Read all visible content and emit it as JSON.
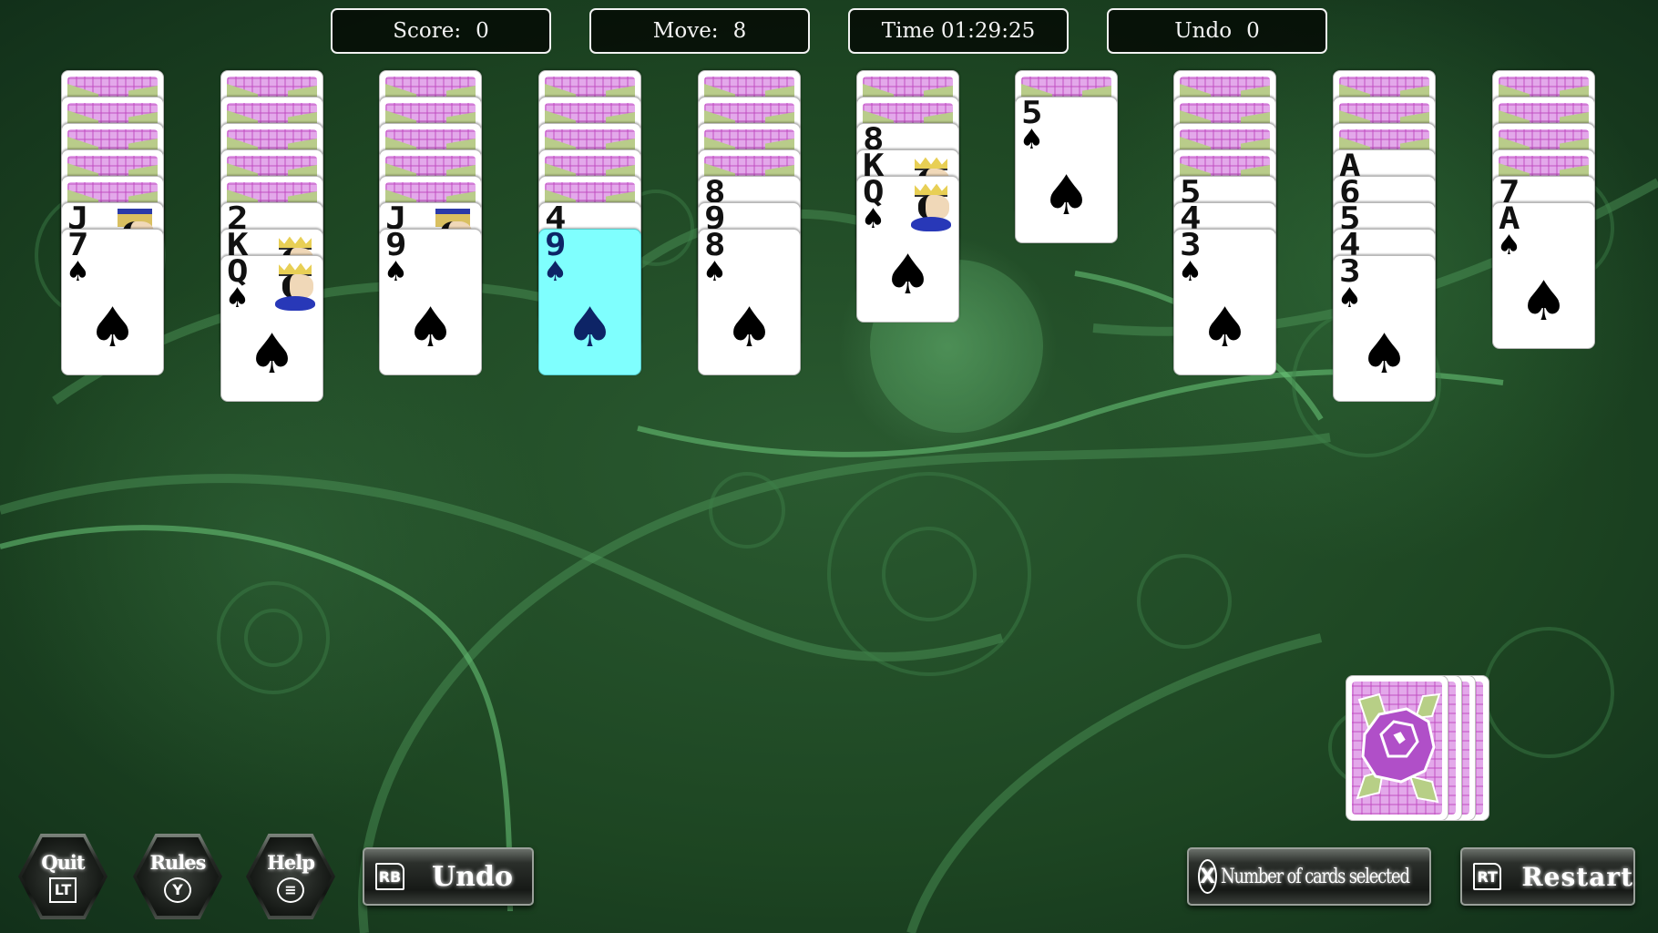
{
  "hud": {
    "score_label": "Score:",
    "score_value": "0",
    "move_label": "Move:",
    "move_value": "8",
    "time_label": "Time",
    "time_value": "01:29:25",
    "undo_label": "Undo",
    "undo_value": "0"
  },
  "colors": {
    "selected_card": "#7ffffe",
    "selected_ink": "#0d2466",
    "card_back": "#e3a8ea",
    "felt": "#1d4522"
  },
  "suit_symbol": "♠",
  "tableau": [
    {
      "hidden": 5,
      "face_up": [
        {
          "rank": "J",
          "royal": "jack"
        },
        {
          "rank": "7"
        }
      ]
    },
    {
      "hidden": 5,
      "face_up": [
        {
          "rank": "2"
        },
        {
          "rank": "K",
          "royal": "king"
        },
        {
          "rank": "Q",
          "royal": "queen"
        }
      ]
    },
    {
      "hidden": 5,
      "face_up": [
        {
          "rank": "J",
          "royal": "jack"
        },
        {
          "rank": "9"
        }
      ]
    },
    {
      "hidden": 5,
      "face_up": [
        {
          "rank": "4"
        },
        {
          "rank": "9",
          "selected": true
        }
      ]
    },
    {
      "hidden": 4,
      "face_up": [
        {
          "rank": "8"
        },
        {
          "rank": "9"
        },
        {
          "rank": "8"
        }
      ]
    },
    {
      "hidden": 2,
      "face_up": [
        {
          "rank": "8"
        },
        {
          "rank": "K",
          "royal": "king"
        },
        {
          "rank": "Q",
          "royal": "queen"
        }
      ]
    },
    {
      "hidden": 1,
      "face_up": [
        {
          "rank": "5"
        }
      ]
    },
    {
      "hidden": 4,
      "face_up": [
        {
          "rank": "5"
        },
        {
          "rank": "4"
        },
        {
          "rank": "3"
        }
      ]
    },
    {
      "hidden": 3,
      "face_up": [
        {
          "rank": "A"
        },
        {
          "rank": "6"
        },
        {
          "rank": "5"
        },
        {
          "rank": "4"
        },
        {
          "rank": "3"
        }
      ]
    },
    {
      "hidden": 4,
      "face_up": [
        {
          "rank": "7"
        },
        {
          "rank": "A"
        }
      ]
    }
  ],
  "stock": {
    "deals_remaining": 4
  },
  "buttons": {
    "quit": {
      "label": "Quit",
      "key": "LT"
    },
    "rules": {
      "label": "Rules",
      "key": "Y"
    },
    "help": {
      "label": "Help",
      "key": "≡"
    },
    "undo": {
      "label": "Undo",
      "key": "RB"
    },
    "num_cards": {
      "label": "Number of cards selected",
      "key": "X"
    },
    "restart": {
      "label": "Restart",
      "key": "RT"
    }
  }
}
